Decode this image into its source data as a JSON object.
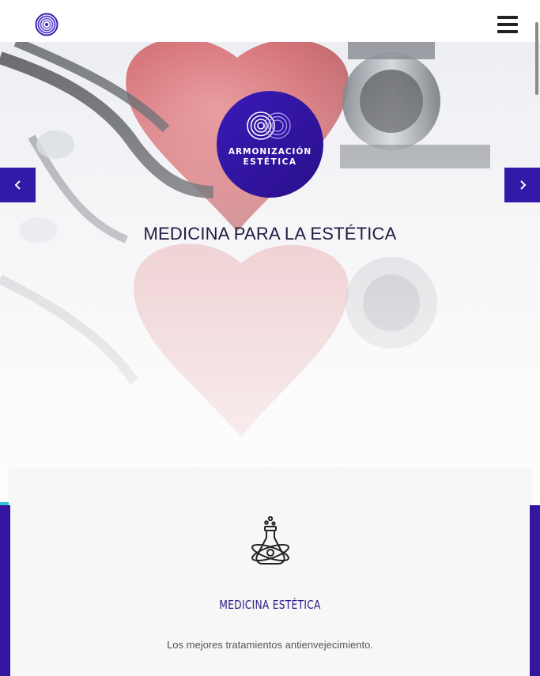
{
  "header": {
    "logo_icon": "spiral-logo-icon",
    "menu_icon": "hamburger-menu-icon"
  },
  "hero": {
    "badge_line1": "ARMONIZACIÓN",
    "badge_line2": "ESTÉTICA",
    "title": "MEDICINA PARA LA ESTÉTICA",
    "prev_icon": "chevron-left-icon",
    "next_icon": "chevron-right-icon"
  },
  "feature": {
    "icon": "flask-atom-icon",
    "title": "MEDICINA ESTÉTICA",
    "text": "Los mejores tratamientos antienvejecimiento."
  },
  "colors": {
    "brand_purple": "#3219a8",
    "accent_cyan": "#2ec4d8",
    "heading_dark": "#1e1b40"
  }
}
